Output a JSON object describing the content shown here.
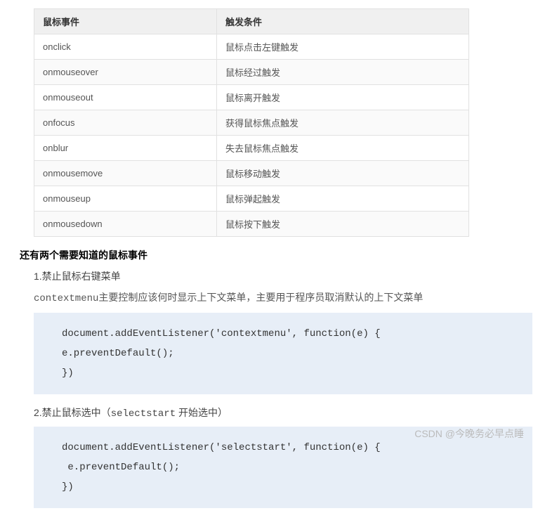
{
  "table": {
    "headers": [
      "鼠标事件",
      "触发条件"
    ],
    "rows": [
      [
        "onclick",
        "鼠标点击左键触发"
      ],
      [
        "onmouseover",
        "鼠标经过触发"
      ],
      [
        "onmouseout",
        "鼠标离开触发"
      ],
      [
        "onfocus",
        "获得鼠标焦点触发"
      ],
      [
        "onblur",
        "失去鼠标焦点触发"
      ],
      [
        "onmousemove",
        "鼠标移动触发"
      ],
      [
        "onmouseup",
        "鼠标弹起触发"
      ],
      [
        "onmousedown",
        "鼠标按下触发"
      ]
    ]
  },
  "section_title": "还有两个需要知道的鼠标事件",
  "item1": {
    "heading": "1.禁止鼠标右键菜单",
    "desc_prefix": "contextmenu",
    "desc_rest": "主要控制应该何时显示上下文菜单，主要用于程序员取消默认的上下文菜单",
    "code": "document.addEventListener('contextmenu', function(e) {\ne.preventDefault();\n})"
  },
  "item2": {
    "heading_prefix": "2.禁止鼠标选中（",
    "heading_code": "selectstart",
    "heading_suffix": " 开始选中）",
    "code": "document.addEventListener('selectstart', function(e) {\n e.preventDefault();\n})"
  },
  "watermark": "CSDN @今晚务必早点睡"
}
